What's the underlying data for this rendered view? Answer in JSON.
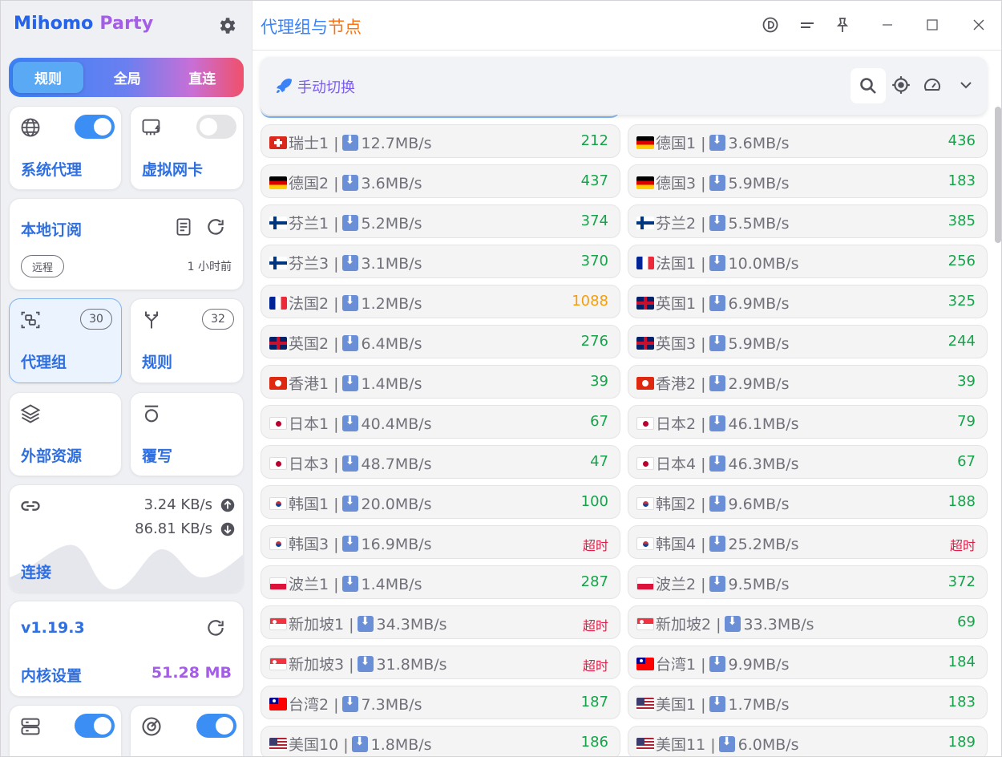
{
  "app": {
    "logo_main": "Mihomo",
    "logo_sub": "Party",
    "page_title_a": "代理组与",
    "page_title_b": "节点"
  },
  "modes": [
    "规则",
    "全局",
    "直连"
  ],
  "cards": {
    "system_proxy": "系统代理",
    "tun": "虚拟网卡",
    "profile": {
      "title": "本地订阅",
      "pill": "远程",
      "updated": "1 小时前"
    },
    "proxy_group": {
      "title": "代理组",
      "count": "30"
    },
    "rules": {
      "title": "规则",
      "count": "32"
    },
    "resources": "外部资源",
    "override": "覆写",
    "connection": {
      "title": "连接",
      "up": "3.24 KB/s",
      "down": "86.81 KB/s"
    },
    "core": {
      "version": "v1.19.3",
      "title": "内核设置",
      "mem": "51.28 MB"
    }
  },
  "group": {
    "name": "手动切换"
  },
  "nodes": [
    {
      "flag": "ch",
      "name": "瑞士1",
      "speed": "12.7MB/s",
      "delay": "212",
      "st": "ok"
    },
    {
      "flag": "de",
      "name": "德国1",
      "speed": "3.6MB/s",
      "delay": "436",
      "st": "ok"
    },
    {
      "flag": "de",
      "name": "德国2",
      "speed": "3.6MB/s",
      "delay": "437",
      "st": "ok"
    },
    {
      "flag": "de",
      "name": "德国3",
      "speed": "5.9MB/s",
      "delay": "183",
      "st": "ok"
    },
    {
      "flag": "fi",
      "name": "芬兰1",
      "speed": "5.2MB/s",
      "delay": "374",
      "st": "ok"
    },
    {
      "flag": "fi",
      "name": "芬兰2",
      "speed": "5.5MB/s",
      "delay": "385",
      "st": "ok"
    },
    {
      "flag": "fi",
      "name": "芬兰3",
      "speed": "3.1MB/s",
      "delay": "370",
      "st": "ok"
    },
    {
      "flag": "fr",
      "name": "法国1",
      "speed": "10.0MB/s",
      "delay": "256",
      "st": "ok"
    },
    {
      "flag": "fr",
      "name": "法国2",
      "speed": "1.2MB/s",
      "delay": "1088",
      "st": "warn"
    },
    {
      "flag": "gb",
      "name": "英国1",
      "speed": "6.9MB/s",
      "delay": "325",
      "st": "ok"
    },
    {
      "flag": "gb",
      "name": "英国2",
      "speed": "6.4MB/s",
      "delay": "276",
      "st": "ok"
    },
    {
      "flag": "gb",
      "name": "英国3",
      "speed": "5.9MB/s",
      "delay": "244",
      "st": "ok"
    },
    {
      "flag": "hk",
      "name": "香港1",
      "speed": "1.4MB/s",
      "delay": "39",
      "st": "ok"
    },
    {
      "flag": "hk",
      "name": "香港2",
      "speed": "2.9MB/s",
      "delay": "39",
      "st": "ok"
    },
    {
      "flag": "jp",
      "name": "日本1",
      "speed": "40.4MB/s",
      "delay": "67",
      "st": "ok"
    },
    {
      "flag": "jp",
      "name": "日本2",
      "speed": "46.1MB/s",
      "delay": "79",
      "st": "ok"
    },
    {
      "flag": "jp",
      "name": "日本3",
      "speed": "48.7MB/s",
      "delay": "47",
      "st": "ok"
    },
    {
      "flag": "jp",
      "name": "日本4",
      "speed": "46.3MB/s",
      "delay": "67",
      "st": "ok"
    },
    {
      "flag": "kr",
      "name": "韩国1",
      "speed": "20.0MB/s",
      "delay": "100",
      "st": "ok"
    },
    {
      "flag": "kr",
      "name": "韩国2",
      "speed": "9.6MB/s",
      "delay": "188",
      "st": "ok"
    },
    {
      "flag": "kr",
      "name": "韩国3",
      "speed": "16.9MB/s",
      "delay": "超时",
      "st": "to"
    },
    {
      "flag": "kr",
      "name": "韩国4",
      "speed": "25.2MB/s",
      "delay": "超时",
      "st": "to"
    },
    {
      "flag": "pl",
      "name": "波兰1",
      "speed": "1.4MB/s",
      "delay": "287",
      "st": "ok"
    },
    {
      "flag": "pl",
      "name": "波兰2",
      "speed": "9.5MB/s",
      "delay": "372",
      "st": "ok"
    },
    {
      "flag": "sg",
      "name": "新加坡1",
      "speed": "34.3MB/s",
      "delay": "超时",
      "st": "to"
    },
    {
      "flag": "sg",
      "name": "新加坡2",
      "speed": "33.3MB/s",
      "delay": "69",
      "st": "ok"
    },
    {
      "flag": "sg",
      "name": "新加坡3",
      "speed": "31.8MB/s",
      "delay": "超时",
      "st": "to"
    },
    {
      "flag": "tw",
      "name": "台湾1",
      "speed": "9.9MB/s",
      "delay": "184",
      "st": "ok"
    },
    {
      "flag": "tw",
      "name": "台湾2",
      "speed": "7.3MB/s",
      "delay": "187",
      "st": "ok"
    },
    {
      "flag": "us",
      "name": "美国1",
      "speed": "1.7MB/s",
      "delay": "183",
      "st": "ok"
    },
    {
      "flag": "us",
      "name": "美国10",
      "speed": "1.8MB/s",
      "delay": "186",
      "st": "ok"
    },
    {
      "flag": "us",
      "name": "美国11",
      "speed": "6.0MB/s",
      "delay": "189",
      "st": "ok"
    }
  ]
}
